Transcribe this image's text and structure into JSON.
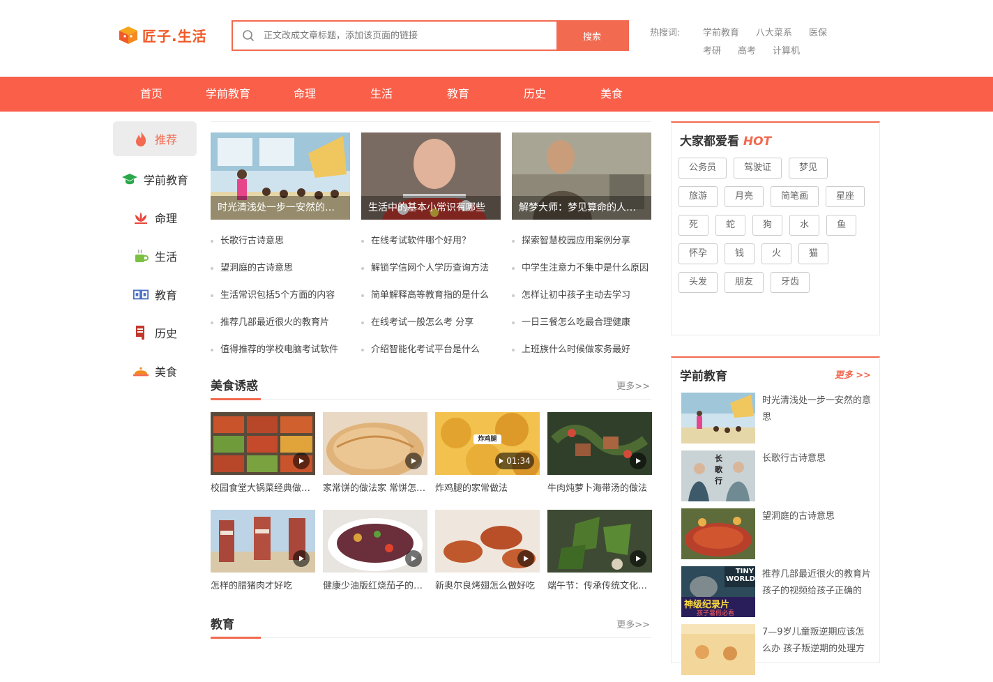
{
  "header": {
    "logo_text": "匠子.生活",
    "search_placeholder": "正文改成文章标题，添加该页面的链接",
    "search_button": "搜索",
    "hot_label": "热搜词:",
    "hot_row1": [
      "学前教育",
      "八大菜系",
      "医保"
    ],
    "hot_row2": [
      "考研",
      "高考",
      "计算机"
    ]
  },
  "nav": [
    "首页",
    "学前教育",
    "命理",
    "生活",
    "教育",
    "历史",
    "美食"
  ],
  "sidebar": [
    {
      "label": "推荐",
      "icon": "fire-icon"
    },
    {
      "label": "学前教育",
      "icon": "graduation-cap-icon"
    },
    {
      "label": "命理",
      "icon": "lotus-icon"
    },
    {
      "label": "生活",
      "icon": "teacup-icon"
    },
    {
      "label": "教育",
      "icon": "book-icon"
    },
    {
      "label": "历史",
      "icon": "scroll-icon"
    },
    {
      "label": "美食",
      "icon": "dish-cover-icon"
    }
  ],
  "features": [
    {
      "caption": "时光清浅处一步一安然的意思"
    },
    {
      "caption": "生活中的基本小常识有哪些"
    },
    {
      "caption": "解梦大师：梦见算命的人是什么意思"
    }
  ],
  "lists": [
    [
      "长歌行古诗意思",
      "望洞庭的古诗意思",
      "生活常识包括5个方面的内容",
      "推荐几部最近很火的教育片",
      "值得推荐的学校电脑考试软件"
    ],
    [
      "在线考试软件哪个好用？",
      "解锁学信网个人学历查询方法",
      "简单解释高等教育指的是什么",
      "在线考试一般怎么考 分享",
      "介绍智能化考试平台是什么"
    ],
    [
      "探索智慧校园应用案例分享",
      "中学生注意力不集中是什么原因",
      "怎样让初中孩子主动去学习",
      "一日三餐怎么吃最合理健康",
      "上班族什么时候做家务最好"
    ]
  ],
  "food_section": {
    "title": "美食诱惑",
    "more": "更多>>",
    "items": [
      {
        "title": "校园食堂大锅菜经典做法分享",
        "duration": ""
      },
      {
        "title": "家常饼的做法家 常饼怎么做",
        "duration": ""
      },
      {
        "title": "炸鸡腿的家常做法",
        "duration": "01:34",
        "badge": "炸鸡腿"
      },
      {
        "title": "牛肉炖萝卜海带汤的做法",
        "duration": ""
      },
      {
        "title": "怎样的腊猪肉才好吃",
        "duration": ""
      },
      {
        "title": "健康少油版红烧茄子的做法",
        "duration": ""
      },
      {
        "title": "新奥尔良烤翅怎么做好吃",
        "duration": ""
      },
      {
        "title": "端午节：传承传统文化吃粽子",
        "duration": ""
      }
    ]
  },
  "edu_section": {
    "title": "教育",
    "more": "更多>>"
  },
  "right": {
    "hot_title": "大家都爱看",
    "hot_word": "HOT",
    "tags": [
      "公务员",
      "驾驶证",
      "梦见",
      "旅游",
      "月亮",
      "简笔画",
      "星座",
      "死",
      "蛇",
      "狗",
      "水",
      "鱼",
      "怀孕",
      "钱",
      "火",
      "猫",
      "头发",
      "朋友",
      "牙齿"
    ],
    "pre_title": "学前教育",
    "pre_more": "更多 >>",
    "articles": [
      "时光清浅处一步一安然的意思",
      "长歌行古诗意思",
      "望洞庭的古诗意思",
      "推荐几部最近很火的教育片 孩子的视频给孩子正确的",
      "7—9岁儿童叛逆期应该怎么办 孩子叛逆期的处理方"
    ],
    "thumb_texts": [
      "TINY WORLD",
      "神级纪录片",
      "孩子暑假必看",
      "长歌行"
    ]
  },
  "colors": {
    "accent": "#f95f49",
    "brand": "#f05a28"
  }
}
